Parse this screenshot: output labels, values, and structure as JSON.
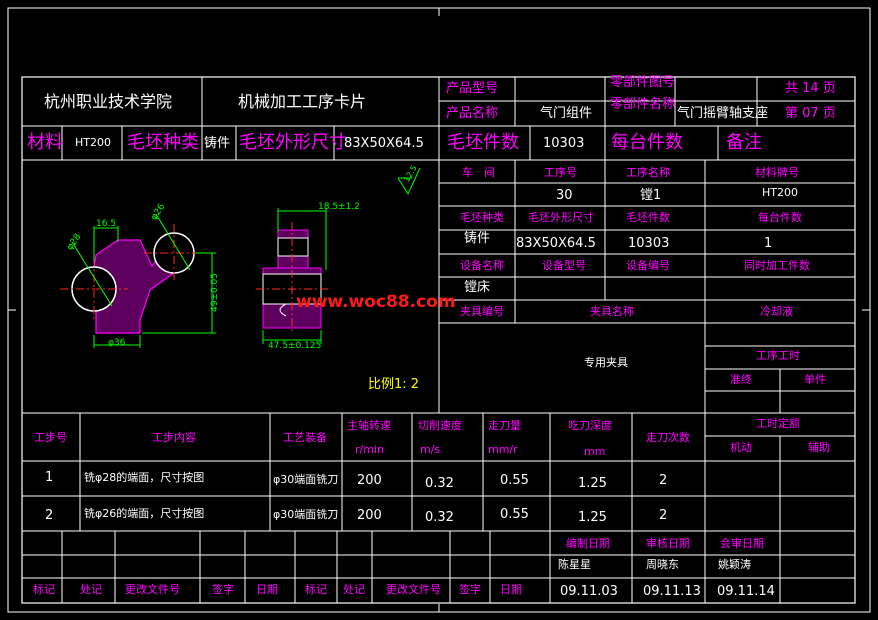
{
  "header": {
    "school": "杭州职业技术学院",
    "card_title": "机械加工工序卡片",
    "product_model_label": "产品型号",
    "part_drawing_label": "零部件图号",
    "product_name_label": "产品名称",
    "product_name_value": "气门组件",
    "part_name_label": "零部件名称",
    "part_name_value": "气门摇臂轴支座",
    "total_pages": "共 14 页",
    "page_no": "第 07 页"
  },
  "material_row": {
    "material_label": "材料",
    "material_value": "HT200",
    "blank_type_label": "毛坯种类",
    "blank_type_value": "铸件",
    "blank_size_label": "毛坯外形尺寸",
    "blank_size_value": "83X50X64.5",
    "blank_count_label": "毛坯件数",
    "blank_count_value": "10303",
    "per_unit_label": "每台件数",
    "remark_label": "备注"
  },
  "right_panel": {
    "workshop_label": "车　间",
    "op_no_label": "工序号",
    "op_name_label": "工序名称",
    "mat_grade_label": "材料牌号",
    "op_no_value": "30",
    "op_name_value": "镗1",
    "mat_grade_value": "HT200",
    "blank_type_label": "毛坯种类",
    "blank_size_label": "毛坯外形尺寸",
    "blank_count_label": "毛坯件数",
    "per_unit_label": "每台件数",
    "blank_type_value": "铸件",
    "blank_size_value": "83X50X64.5",
    "blank_count_value": "10303",
    "per_unit_value": "1",
    "equip_name_label": "设备名称",
    "equip_model_label": "设备型号",
    "equip_no_label": "设备编号",
    "simul_label": "同时加工件数",
    "equip_name_value": "镗床",
    "fixture_no_label": "夹具编号",
    "fixture_name_label": "夹具名称",
    "coolant_label": "冷却液",
    "fixture_name_value": "专用夹具",
    "op_time_label": "工序工时",
    "prep_label": "准终",
    "unit_label": "单件"
  },
  "drawing": {
    "dim_phi28": "φ28",
    "dim_16_5": "16.5",
    "dim_phi26": "φ26",
    "dim_phi36": "φ36",
    "dim_49": "49±0.05",
    "dim_18_5": "18.5±1.2",
    "dim_47_5": "47.5±0.125",
    "roughness": "12.5",
    "scale": "比例1: 2"
  },
  "steps_table": {
    "headers": {
      "step_no": "工步号",
      "step_content": "工步内容",
      "equipment": "工艺装备",
      "spindle": "主轴转速",
      "spindle_unit": "r/min",
      "cut_speed": "切削速度",
      "cut_speed_unit": "m/s",
      "feed": "走刀量",
      "feed_unit": "mm/r",
      "depth": "吃刀深度",
      "depth_unit": "mm",
      "passes": "走刀次数",
      "time_quota": "工时定额",
      "machine": "机动",
      "aux": "辅助"
    },
    "rows": [
      {
        "no": "1",
        "content": "铣φ28的端面，尺寸按图",
        "equip": "φ30端面铣刀",
        "spindle": "200",
        "speed": "0.32",
        "feed": "0.55",
        "depth": "1.25",
        "passes": "2"
      },
      {
        "no": "2",
        "content": "铣φ26的端面，尺寸按图",
        "equip": "φ30端面铣刀",
        "spindle": "200",
        "speed": "0.32",
        "feed": "0.55",
        "depth": "1.25",
        "passes": "2"
      }
    ]
  },
  "footer": {
    "compile_date_label": "编制日期",
    "review_date_label": "审核日期",
    "approve_date_label": "会审日期",
    "compiler": "陈星星",
    "reviewer": "周晓东",
    "approver": "姚颖涛",
    "compile_date": "09.11.03",
    "review_date": "09.11.13",
    "approve_date": "09.11.14",
    "mark_label": "标记",
    "count_label": "处记",
    "change_doc_label": "更改文件号",
    "sign_label": "签字",
    "date_label": "日期"
  },
  "watermark": "www.woc88.com"
}
